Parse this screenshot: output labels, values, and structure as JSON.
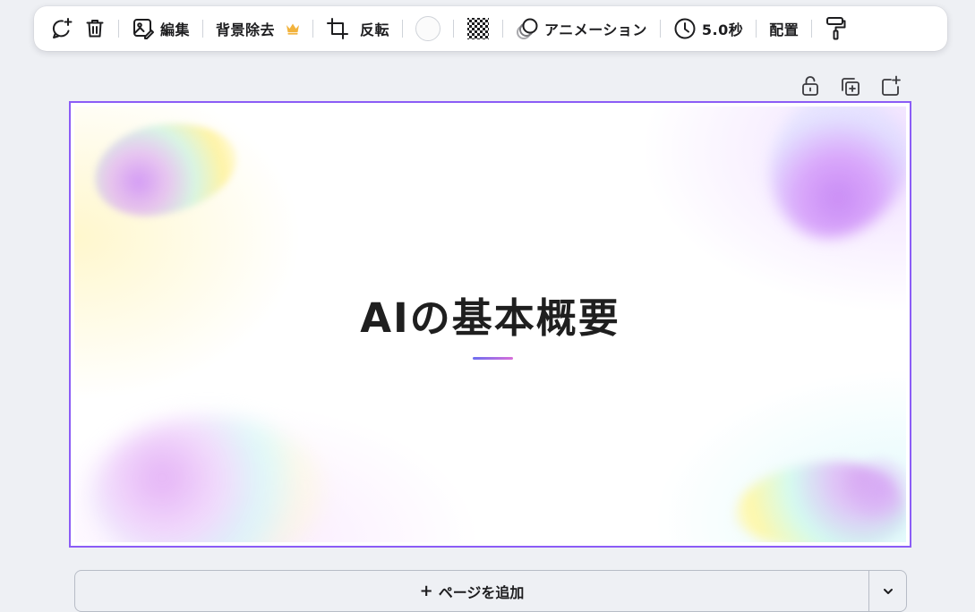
{
  "toolbar": {
    "items": [
      {
        "id": "comment",
        "icon": "comment-add-icon"
      },
      {
        "id": "delete",
        "icon": "trash-icon"
      },
      {
        "id": "edit",
        "icon": "image-edit-icon",
        "label": "編集"
      },
      {
        "id": "bg_remove",
        "label": "背景除去",
        "icon": "crown-icon",
        "premium_color": "#f2b33d"
      },
      {
        "id": "crop",
        "icon": "crop-icon"
      },
      {
        "id": "flip",
        "label": "反転"
      },
      {
        "id": "color",
        "icon": "color-swatch",
        "swatch_color": "#fbfbfb"
      },
      {
        "id": "transparency",
        "icon": "checkerboard-icon"
      },
      {
        "id": "animation",
        "icon": "animation-icon",
        "label": "アニメーション"
      },
      {
        "id": "duration",
        "icon": "clock-icon",
        "label": "5.0秒"
      },
      {
        "id": "position",
        "label": "配置"
      },
      {
        "id": "paint",
        "icon": "paint-roller-icon"
      }
    ]
  },
  "page_actions": [
    {
      "id": "lock",
      "icon": "unlock-icon"
    },
    {
      "id": "duplicate",
      "icon": "duplicate-page-icon"
    },
    {
      "id": "add",
      "icon": "add-page-icon"
    }
  ],
  "slide": {
    "title": "AIの基本概要",
    "frame_color": "#8b5cf6",
    "underline_colors": [
      "#6d6ef0",
      "#d86ed9"
    ]
  },
  "add_page": {
    "plus": "+",
    "label": "ページを追加",
    "caret_icon": "chevron-down-icon"
  }
}
